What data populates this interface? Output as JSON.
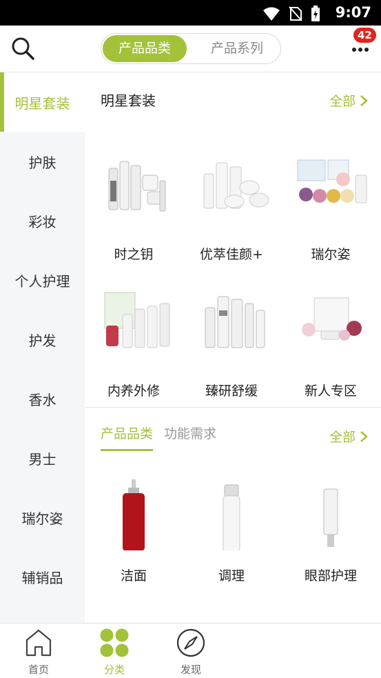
{
  "status_bar": {
    "time": "9:07"
  },
  "header": {
    "tabs": [
      {
        "label": "产品品类"
      },
      {
        "label": "产品系列"
      }
    ],
    "notification_count": "42"
  },
  "sidebar": {
    "items": [
      {
        "label": "明星套装"
      },
      {
        "label": "护肤"
      },
      {
        "label": "彩妆"
      },
      {
        "label": "个人护理"
      },
      {
        "label": "护发"
      },
      {
        "label": "香水"
      },
      {
        "label": "男士"
      },
      {
        "label": "瑞尔姿"
      },
      {
        "label": "辅销品"
      }
    ]
  },
  "star_sets": {
    "title": "明星套装",
    "all_label": "全部",
    "items": [
      {
        "label": "时之钥"
      },
      {
        "label": "优萃佳颜+"
      },
      {
        "label": "瑞尔姿"
      },
      {
        "label": "内养外修"
      },
      {
        "label": "臻研舒缓"
      },
      {
        "label": "新人专区"
      }
    ]
  },
  "category_section": {
    "tabs": [
      {
        "label": "产品品类"
      },
      {
        "label": "功能需求"
      }
    ],
    "all_label": "全部",
    "items": [
      {
        "label": "洁面"
      },
      {
        "label": "调理"
      },
      {
        "label": "眼部护理"
      }
    ]
  },
  "tabbar": {
    "items": [
      {
        "label": "首页"
      },
      {
        "label": "分类"
      },
      {
        "label": "发现"
      }
    ]
  },
  "colors": {
    "accent": "#a3c23a",
    "badge": "#e1251b"
  }
}
